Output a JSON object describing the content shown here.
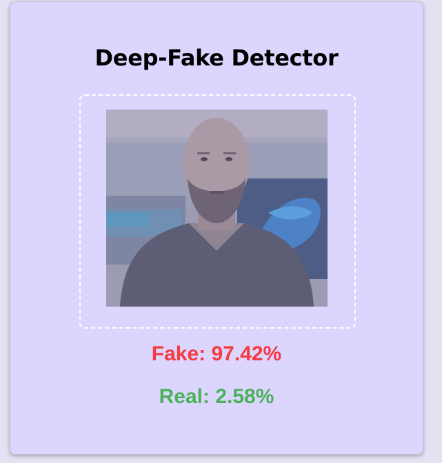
{
  "app": {
    "title": "Deep-Fake Detector"
  },
  "upload": {
    "preview_alt": "Uploaded face image"
  },
  "results": {
    "fake_label": "Fake:",
    "fake_value": "97.42%",
    "real_label": "Real:",
    "real_value": "2.58%"
  },
  "colors": {
    "card_background": "#dcd6ff",
    "fake": "#f63a3f",
    "real": "#4bb158",
    "title": "#000000",
    "dropzone_border": "#ffffff"
  }
}
